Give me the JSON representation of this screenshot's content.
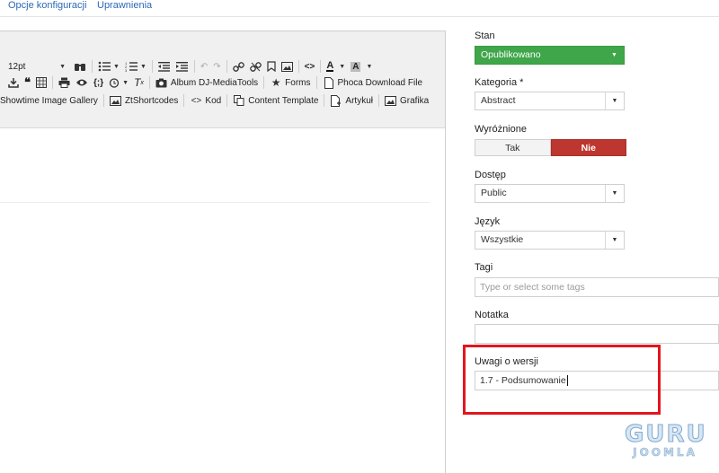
{
  "tabs": [
    "Opcje konfiguracji",
    "Uprawnienia"
  ],
  "toolbar": {
    "font_size": "12pt",
    "row3": [
      "Album DJ-MediaTools",
      "Forms",
      "Phoca Download File"
    ],
    "row4": [
      "Showtime Image Gallery",
      "ZtShortcodes",
      "Kod",
      "Content Template",
      "Artykuł",
      "Grafika"
    ]
  },
  "sidebar": {
    "stan": {
      "label": "Stan",
      "value": "Opublikowano"
    },
    "kategoria": {
      "label": "Kategoria *",
      "value": "Abstract"
    },
    "wyroznione": {
      "label": "Wyróżnione",
      "tak": "Tak",
      "nie": "Nie",
      "selected": "Nie"
    },
    "dostep": {
      "label": "Dostęp",
      "value": "Public"
    },
    "jezyk": {
      "label": "Język",
      "value": "Wszystkie"
    },
    "tagi": {
      "label": "Tagi",
      "placeholder": "Type or select some tags"
    },
    "notatka": {
      "label": "Notatka",
      "value": ""
    },
    "uwagi": {
      "label": "Uwagi o wersji",
      "value": "1.7 - Podsumowanie"
    }
  },
  "logo": {
    "line1": "GURU",
    "line2": "JOOMLA"
  },
  "colors": {
    "accent_green": "#3fa64a",
    "accent_red": "#bd362f",
    "highlight": "#e2161d",
    "link": "#2a69b8"
  }
}
